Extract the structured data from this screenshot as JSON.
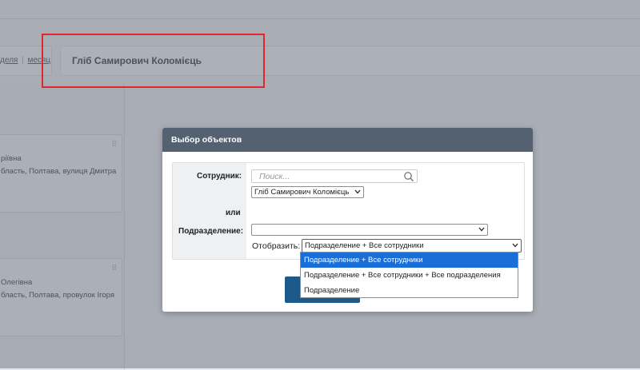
{
  "period_nav": {
    "week_label": "деля",
    "separator": "|",
    "month_label": "месяц"
  },
  "header": {
    "employee_name": "Гліб Самирович Коломієць"
  },
  "cards": [
    {
      "line1": "ріївна",
      "line2": "бласть, Полтава, вулиця Дмитра"
    },
    {
      "line1": "Олегівна",
      "line2": "бласть, Полтава, провулок Ігоря"
    }
  ],
  "modal": {
    "title": "Выбор объектов",
    "employee_label": "Сотрудник:",
    "search_placeholder": "Поиск...",
    "employee_selected": "Гліб Самирович Коломієць",
    "or_label": "или",
    "department_label": "Подразделение:",
    "department_selected": "",
    "show_label": "Отобразить:",
    "show_selected": "Подразделение + Все сотрудники",
    "show_options": [
      "Подразделение + Все сотрудники",
      "Подразделение + Все сотрудники + Все подразделения",
      "Подразделение"
    ]
  },
  "colors": {
    "modal_header": "#536171",
    "highlight": "#e2262b",
    "selected_option": "#1a6ed8",
    "primary_button": "#1b5a8a"
  },
  "icons": [
    "search-icon",
    "chevron-down-icon",
    "drag-handle-icon"
  ]
}
